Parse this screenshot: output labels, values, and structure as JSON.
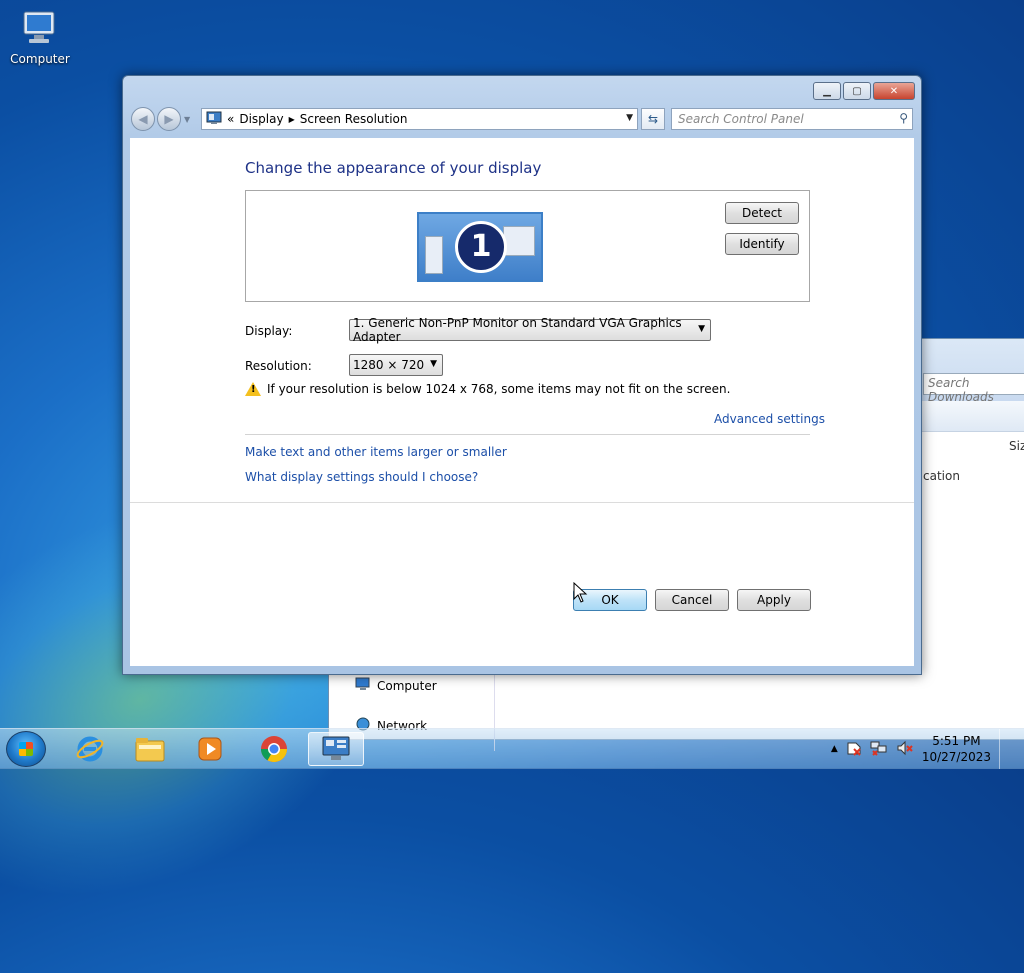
{
  "desktop": {
    "computer_icon_label": "Computer"
  },
  "background_window": {
    "search_placeholder": "Search Downloads",
    "column_header": "Siz",
    "partial_text": "cation",
    "nav_items": [
      "Computer",
      "Network"
    ]
  },
  "window": {
    "address": {
      "crumb1": "Display",
      "crumb2": "Screen Resolution"
    },
    "search_placeholder": "Search Control Panel",
    "heading": "Change the appearance of your display",
    "monitor_number": "1",
    "detect_label": "Detect",
    "identify_label": "Identify",
    "display_label": "Display:",
    "display_value": "1. Generic Non-PnP Monitor on Standard VGA Graphics Adapter",
    "resolution_label": "Resolution:",
    "resolution_value": "1280 × 720",
    "warning_text": "If your resolution is below 1024 x 768, some items may not fit on the screen.",
    "advanced_link": "Advanced settings",
    "link_text_size": "Make text and other items larger or smaller",
    "link_which_settings": "What display settings should I choose?",
    "ok_label": "OK",
    "cancel_label": "Cancel",
    "apply_label": "Apply"
  },
  "taskbar": {
    "time": "5:51 PM",
    "date": "10/27/2023"
  }
}
